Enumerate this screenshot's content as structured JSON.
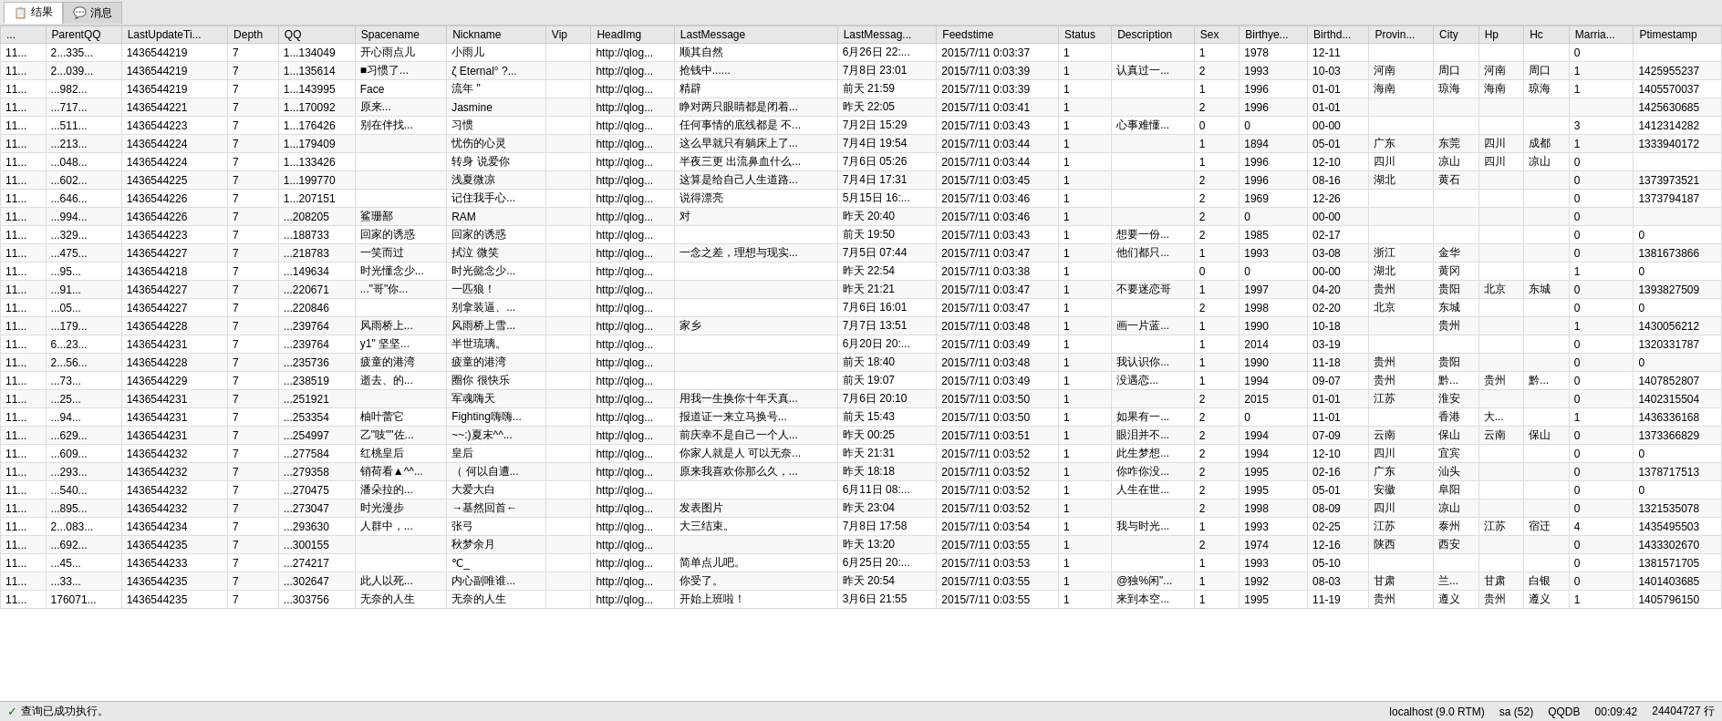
{
  "tabs": [
    {
      "id": "results",
      "label": "结果",
      "icon": "📋",
      "active": true
    },
    {
      "id": "messages",
      "label": "消息",
      "icon": "💬",
      "active": false
    }
  ],
  "columns": [
    {
      "id": "col0",
      "label": "..."
    },
    {
      "id": "parentqq",
      "label": "ParentQQ"
    },
    {
      "id": "lastupdateti",
      "label": "LastUpdateTi..."
    },
    {
      "id": "depth",
      "label": "Depth"
    },
    {
      "id": "qq",
      "label": "QQ"
    },
    {
      "id": "spacename",
      "label": "Spacename"
    },
    {
      "id": "nickname",
      "label": "Nickname"
    },
    {
      "id": "vip",
      "label": "Vip"
    },
    {
      "id": "headimg",
      "label": "HeadImg"
    },
    {
      "id": "lastmessage",
      "label": "LastMessage"
    },
    {
      "id": "lastmessagetime",
      "label": "LastMessag..."
    },
    {
      "id": "feedstime",
      "label": "Feedstime"
    },
    {
      "id": "status",
      "label": "Status"
    },
    {
      "id": "description",
      "label": "Description"
    },
    {
      "id": "sex",
      "label": "Sex"
    },
    {
      "id": "birthye",
      "label": "Birthye..."
    },
    {
      "id": "birthd",
      "label": "Birthd..."
    },
    {
      "id": "provin",
      "label": "Provin..."
    },
    {
      "id": "city",
      "label": "City"
    },
    {
      "id": "hp",
      "label": "Hp"
    },
    {
      "id": "hc",
      "label": "Hc"
    },
    {
      "id": "marria",
      "label": "Marria..."
    },
    {
      "id": "ptimestamp",
      "label": "Ptimestamp"
    }
  ],
  "rows": [
    [
      "11...",
      "2...335...",
      "1436544219",
      "7",
      "1...134049",
      "开心雨点儿",
      "小雨儿",
      "",
      "http://qlog...",
      "顺其自然",
      "6月26日 22:...",
      "2015/7/11 0:03:37",
      "1",
      "",
      "1",
      "1978",
      "12-11",
      "",
      "",
      "",
      "",
      "0",
      ""
    ],
    [
      "11...",
      "2...039...",
      "1436544219",
      "7",
      "1...135614",
      "■习惯了...",
      "ζ Eternal° ?...",
      "",
      "http://qlog...",
      "抢钱中......",
      "7月8日 23:01",
      "2015/7/11 0:03:39",
      "1",
      "认真过一...",
      "2",
      "1993",
      "10-03",
      "河南",
      "周口",
      "河南",
      "周口",
      "1",
      "1425955237"
    ],
    [
      "11...",
      "...982...",
      "1436544219",
      "7",
      "1...143995",
      "Face",
      "流年 \"",
      "",
      "http://qlog...",
      "精辟",
      "前天 21:59",
      "2015/7/11 0:03:39",
      "1",
      "",
      "1",
      "1996",
      "01-01",
      "海南",
      "琼海",
      "海南",
      "琼海",
      "1",
      "1405570037"
    ],
    [
      "11...",
      "...717...",
      "1436544221",
      "7",
      "1...170092",
      "原来...",
      "Jasmine",
      "",
      "http://qlog...",
      "睁对两只眼睛都是闭着...",
      "昨天 22:05",
      "2015/7/11 0:03:41",
      "1",
      "",
      "2",
      "1996",
      "01-01",
      "",
      "",
      "",
      "",
      "",
      "1425630685"
    ],
    [
      "11...",
      "...511...",
      "1436544223",
      "7",
      "1...176426",
      "别在伴找...",
      "习惯",
      "",
      "http://qlog...",
      "任何事情的底线都是 不...",
      "7月2日 15:29",
      "2015/7/11 0:03:43",
      "1",
      "心事难懂...",
      "0",
      "0",
      "00-00",
      "",
      "",
      "",
      "",
      "3",
      "1412314282"
    ],
    [
      "11...",
      "...213...",
      "1436544224",
      "7",
      "1...179409",
      "",
      "忧伤的心灵",
      "",
      "http://qlog...",
      "这么早就只有躺床上了...",
      "7月4日 19:54",
      "2015/7/11 0:03:44",
      "1",
      "",
      "1",
      "1894",
      "05-01",
      "广东",
      "东莞",
      "四川",
      "成都",
      "1",
      "1333940172"
    ],
    [
      "11...",
      "...048...",
      "1436544224",
      "7",
      "1...133426",
      "",
      "转身 说爱你",
      "",
      "http://qlog...",
      "半夜三更 出流鼻血什么...",
      "7月6日 05:26",
      "2015/7/11 0:03:44",
      "1",
      "",
      "1",
      "1996",
      "12-10",
      "四川",
      "凉山",
      "四川",
      "凉山",
      "0",
      ""
    ],
    [
      "11...",
      "...602...",
      "1436544225",
      "7",
      "1...199770",
      "",
      "浅夏微凉",
      "",
      "http://qlog...",
      "这算是给自己人生道路...",
      "7月4日 17:31",
      "2015/7/11 0:03:45",
      "1",
      "",
      "2",
      "1996",
      "08-16",
      "湖北",
      "黄石",
      "",
      "",
      "0",
      "1373973521"
    ],
    [
      "11...",
      "...646...",
      "1436544226",
      "7",
      "1...207151",
      "",
      "记住我手心...",
      "",
      "http://qlog...",
      "说得漂亮",
      "5月15日 16:...",
      "2015/7/11 0:03:46",
      "1",
      "",
      "2",
      "1969",
      "12-26",
      "",
      "",
      "",
      "",
      "0",
      "1373794187"
    ],
    [
      "11...",
      "...994...",
      "1436544226",
      "7",
      "...208205",
      "鲨珊鄯",
      "RAM",
      "",
      "http://qlog...",
      "对",
      "昨天 20:40",
      "2015/7/11 0:03:46",
      "1",
      "",
      "2",
      "0",
      "00-00",
      "",
      "",
      "",
      "",
      "0",
      ""
    ],
    [
      "11...",
      "...329...",
      "1436544223",
      "7",
      "...188733",
      "回家的诱惑",
      "回家的诱惑",
      "",
      "http://qlog...",
      "",
      "前天 19:50",
      "2015/7/11 0:03:43",
      "1",
      "想要一份...",
      "2",
      "1985",
      "02-17",
      "",
      "",
      "",
      "",
      "0",
      "0"
    ],
    [
      "11...",
      "...475...",
      "1436544227",
      "7",
      "...218783",
      "一笑而过",
      "拭泣 微笑",
      "",
      "http://qlog...",
      "一念之差，理想与现实...",
      "7月5日 07:44",
      "2015/7/11 0:03:47",
      "1",
      "他们都只...",
      "1",
      "1993",
      "03-08",
      "浙江",
      "金华",
      "",
      "",
      "0",
      "1381673866"
    ],
    [
      "11...",
      "...95...",
      "1436544218",
      "7",
      "...149634",
      "时光懂念少...",
      "时光懿念少...",
      "",
      "http://qlog...",
      "",
      "昨天 22:54",
      "2015/7/11 0:03:38",
      "1",
      "",
      "0",
      "0",
      "00-00",
      "湖北",
      "黄冈",
      "",
      "",
      "1",
      "0"
    ],
    [
      "11...",
      "...91...",
      "1436544227",
      "7",
      "...220671",
      "...\"哥\"你...",
      "一匹狼！",
      "",
      "http://qlog...",
      "",
      "昨天 21:21",
      "2015/7/11 0:03:47",
      "1",
      "不要迷恋哥",
      "1",
      "1997",
      "04-20",
      "贵州",
      "贵阳",
      "北京",
      "东城",
      "0",
      "1393827509"
    ],
    [
      "11...",
      "...05...",
      "1436544227",
      "7",
      "...220846",
      "",
      "别拿装逼、...",
      "",
      "http://qlog...",
      "",
      "7月6日 16:01",
      "2015/7/11 0:03:47",
      "1",
      "",
      "2",
      "1998",
      "02-20",
      "北京",
      "东城",
      "",
      "",
      "0",
      "0"
    ],
    [
      "11...",
      "...179...",
      "1436544228",
      "7",
      "...239764",
      "风雨桥上...",
      "风雨桥上雪...",
      "",
      "http://qlog...",
      "家乡",
      "7月7日 13:51",
      "2015/7/11 0:03:48",
      "1",
      "画一片蓝...",
      "1",
      "1990",
      "10-18",
      "",
      "贵州",
      "",
      "",
      "1",
      "1430056212"
    ],
    [
      "11...",
      "6...23...",
      "1436544231",
      "7",
      "...239764",
      "y1\" 坚坚...",
      "半世琉璃。",
      "",
      "http://qlog...",
      "",
      "6月20日 20:...",
      "2015/7/11 0:03:49",
      "1",
      "",
      "1",
      "2014",
      "03-19",
      "",
      "",
      "",
      "",
      "0",
      "1320331787"
    ],
    [
      "11...",
      "2...56...",
      "1436544228",
      "7",
      "...235736",
      "疲童的港湾",
      "疲童的港湾",
      "",
      "http://qlog...",
      "",
      "前天 18:40",
      "2015/7/11 0:03:48",
      "1",
      "我认识你...",
      "1",
      "1990",
      "11-18",
      "贵州",
      "贵阳",
      "",
      "",
      "0",
      "0"
    ],
    [
      "11...",
      "...73...",
      "1436544229",
      "7",
      "...238519",
      "逝去、的...",
      "圈你 很快乐",
      "",
      "http://qlog...",
      "",
      "前天 19:07",
      "2015/7/11 0:03:49",
      "1",
      "没遇恋...",
      "1",
      "1994",
      "09-07",
      "贵州",
      "黔...",
      "贵州",
      "黔...",
      "0",
      "1407852807"
    ],
    [
      "11...",
      "...25...",
      "1436544231",
      "7",
      "...251921",
      "",
      "军魂嗨天",
      "",
      "http://qlog...",
      "用我一生换你十年天真...",
      "7月6日 20:10",
      "2015/7/11 0:03:50",
      "1",
      "",
      "2",
      "2015",
      "01-01",
      "江苏",
      "淮安",
      "",
      "",
      "0",
      "1402315504"
    ],
    [
      "11...",
      "...94...",
      "1436544231",
      "7",
      "...253354",
      "柚叶蕾它",
      "Fighting嗨嗨...",
      "",
      "http://qlog...",
      "报道证一来立马换号...",
      "前天 15:43",
      "2015/7/11 0:03:50",
      "1",
      "如果有一...",
      "2",
      "0",
      "11-01",
      "",
      "香港",
      "大...",
      "",
      "1",
      "1436336168"
    ],
    [
      "11...",
      "...629...",
      "1436544231",
      "7",
      "...254997",
      "乙\"吱\"\"佐...",
      "~~:)夏末^^...",
      "",
      "http://qlog...",
      "前庆幸不是自己一个人...",
      "昨天 00:25",
      "2015/7/11 0:03:51",
      "1",
      "眼泪并不...",
      "2",
      "1994",
      "07-09",
      "云南",
      "保山",
      "云南",
      "保山",
      "0",
      "1373366829"
    ],
    [
      "11...",
      "...609...",
      "1436544232",
      "7",
      "...277584",
      "红桃皇后",
      "皇后",
      "",
      "http://qlog...",
      "你家人就是人 可以无奈...",
      "昨天 21:31",
      "2015/7/11 0:03:52",
      "1",
      "此生梦想...",
      "2",
      "1994",
      "12-10",
      "四川",
      "宜宾",
      "",
      "",
      "0",
      "0"
    ],
    [
      "11...",
      "...293...",
      "1436544232",
      "7",
      "...279358",
      "销荷看▲^^...",
      "（ 何以自遭...",
      "",
      "http://qlog...",
      "原来我喜欢你那么久，...",
      "昨天 18:18",
      "2015/7/11 0:03:52",
      "1",
      "你咋你没...",
      "2",
      "1995",
      "02-16",
      "广东",
      "汕头",
      "",
      "",
      "0",
      "1378717513"
    ],
    [
      "11...",
      "...540...",
      "1436544232",
      "7",
      "...270475",
      "潘朵拉的...",
      "大爱大白",
      "",
      "http://qlog...",
      "",
      "6月11日 08:...",
      "2015/7/11 0:03:52",
      "1",
      "人生在世...",
      "2",
      "1995",
      "05-01",
      "安徽",
      "阜阳",
      "",
      "",
      "0",
      "0"
    ],
    [
      "11...",
      "...895...",
      "1436544232",
      "7",
      "...273047",
      "时光漫步",
      "→基然回首←",
      "",
      "http://qlog...",
      "发表图片",
      "昨天 23:04",
      "2015/7/11 0:03:52",
      "1",
      "",
      "2",
      "1998",
      "08-09",
      "四川",
      "凉山",
      "",
      "",
      "0",
      "1321535078"
    ],
    [
      "11...",
      "2...083...",
      "1436544234",
      "7",
      "...293630",
      "人群中，...",
      "张弓",
      "",
      "http://qlog...",
      "大三结束。",
      "7月8日 17:58",
      "2015/7/11 0:03:54",
      "1",
      "我与时光...",
      "1",
      "1993",
      "02-25",
      "江苏",
      "泰州",
      "江苏",
      "宿迁",
      "4",
      "1435495503"
    ],
    [
      "11...",
      "...692...",
      "1436544235",
      "7",
      "...300155",
      "",
      "秋梦余月",
      "",
      "http://qlog...",
      "",
      "昨天 13:20",
      "2015/7/11 0:03:55",
      "1",
      "",
      "2",
      "1974",
      "12-16",
      "陕西",
      "西安",
      "",
      "",
      "0",
      "1433302670"
    ],
    [
      "11...",
      "...45...",
      "1436544233",
      "7",
      "...274217",
      "",
      "℃_",
      "",
      "http://qlog...",
      "简单点儿吧。",
      "6月25日 20:...",
      "2015/7/11 0:03:53",
      "1",
      "",
      "1",
      "1993",
      "05-10",
      "",
      "",
      "",
      "",
      "0",
      "1381571705"
    ],
    [
      "11...",
      "...33...",
      "1436544235",
      "7",
      "...302647",
      "此人以死...",
      "内心副唯谁...",
      "",
      "http://qlog...",
      "你受了。",
      "昨天 20:54",
      "2015/7/11 0:03:55",
      "1",
      "@独%闲\"...",
      "1",
      "1992",
      "08-03",
      "甘肃",
      "兰...",
      "甘肃",
      "白银",
      "0",
      "1401403685"
    ],
    [
      "11...",
      "176071...",
      "1436544235",
      "7",
      "...303756",
      "无奈的人生",
      "无奈的人生",
      "",
      "http://qlog...",
      "开始上班啦！",
      "3月6日 21:55",
      "2015/7/11 0:03:55",
      "1",
      "来到本空...",
      "1",
      "1995",
      "11-19",
      "贵州",
      "遵义",
      "贵州",
      "遵义",
      "1",
      "1405796150"
    ]
  ],
  "status": {
    "left": "✓ 查询已成功执行。",
    "items": [
      {
        "label": "localhost (9.0 RTM)"
      },
      {
        "label": "sa (52)"
      },
      {
        "label": "QQDB"
      },
      {
        "label": "00:09:42"
      },
      {
        "label": "24404727 行"
      }
    ]
  }
}
